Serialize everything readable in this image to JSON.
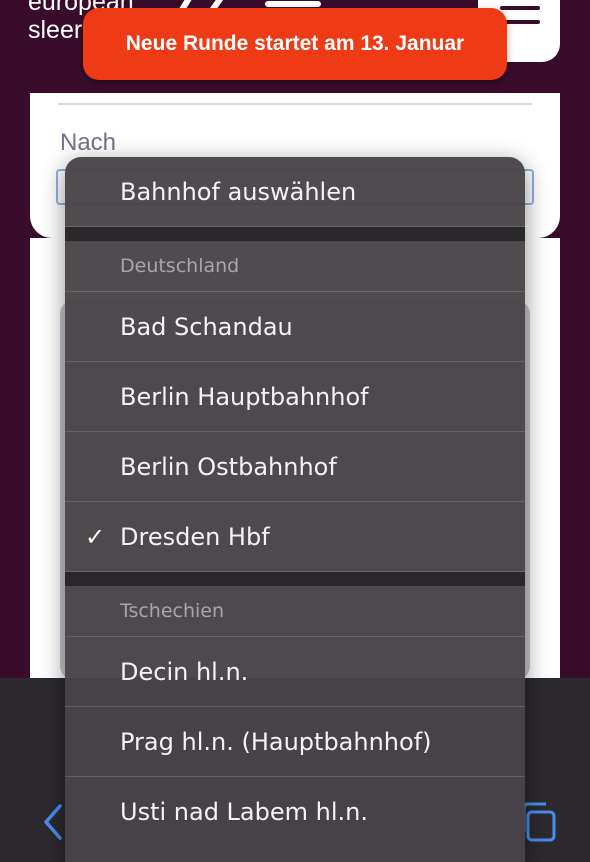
{
  "header": {
    "logo_line1": "european",
    "logo_line2": "sleer",
    "menu_icon": "hamburger-menu-icon"
  },
  "banner": {
    "text": "Neue Runde startet am 13. Januar",
    "color": "#ef3a16"
  },
  "form": {
    "field_label": "Nach"
  },
  "picker": {
    "placeholder": "Bahnhof auswählen",
    "sections": [
      {
        "title": "Deutschland",
        "options": [
          {
            "label": "Bad Schandau",
            "selected": false
          },
          {
            "label": "Berlin Hauptbahnhof",
            "selected": false
          },
          {
            "label": "Berlin Ostbahnhof",
            "selected": false
          },
          {
            "label": "Dresden Hbf",
            "selected": true
          }
        ]
      },
      {
        "title": "Tschechien",
        "options": [
          {
            "label": "Decin hl.n.",
            "selected": false
          },
          {
            "label": "Prag hl.n. (Hauptbahnhof)",
            "selected": false
          },
          {
            "label": "Usti nad Labem hl.n.",
            "selected": false
          }
        ]
      }
    ],
    "check_glyph": "✓"
  },
  "toolbar": {
    "back_icon": "chevron-left-icon",
    "tabs_icon": "tabs-icon",
    "accent": "#4a8ef0"
  }
}
